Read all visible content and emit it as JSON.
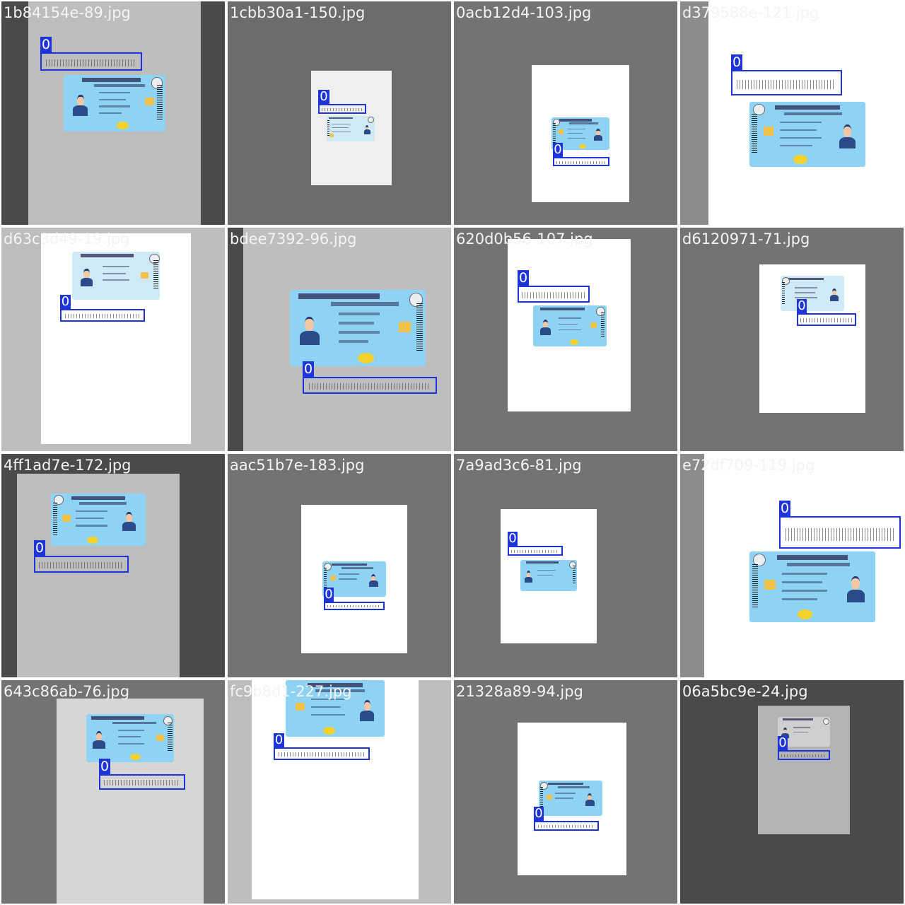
{
  "tiles": [
    {
      "file": "1b84154e-89.jpg",
      "label": "0"
    },
    {
      "file": "1cbb30a1-150.jpg",
      "label": "0"
    },
    {
      "file": "0acb12d4-103.jpg",
      "label": "0"
    },
    {
      "file": "d379588e-121.jpg",
      "label": "0"
    },
    {
      "file": "d63c3d49-19.jpg",
      "label": "0"
    },
    {
      "file": "bdee7392-96.jpg",
      "label": "0"
    },
    {
      "file": "620d0b56-107.jpg",
      "label": "0"
    },
    {
      "file": "d6120971-71.jpg",
      "label": "0"
    },
    {
      "file": "4ff1ad7e-172.jpg",
      "label": "0"
    },
    {
      "file": "aac51b7e-183.jpg",
      "label": "0"
    },
    {
      "file": "7a9ad3c6-81.jpg",
      "label": "0"
    },
    {
      "file": "e72df709-119.jpg",
      "label": "0"
    },
    {
      "file": "643c86ab-76.jpg",
      "label": "0"
    },
    {
      "file": "fc9b8d1-227.jpg",
      "label": "0"
    },
    {
      "file": "21328a89-94.jpg",
      "label": "0"
    },
    {
      "file": "06a5bc9e-24.jpg",
      "label": "0"
    }
  ],
  "colors": {
    "box": "#1d34d8",
    "card": "#8fd3f4",
    "filename_text": "#f4f4f4"
  }
}
